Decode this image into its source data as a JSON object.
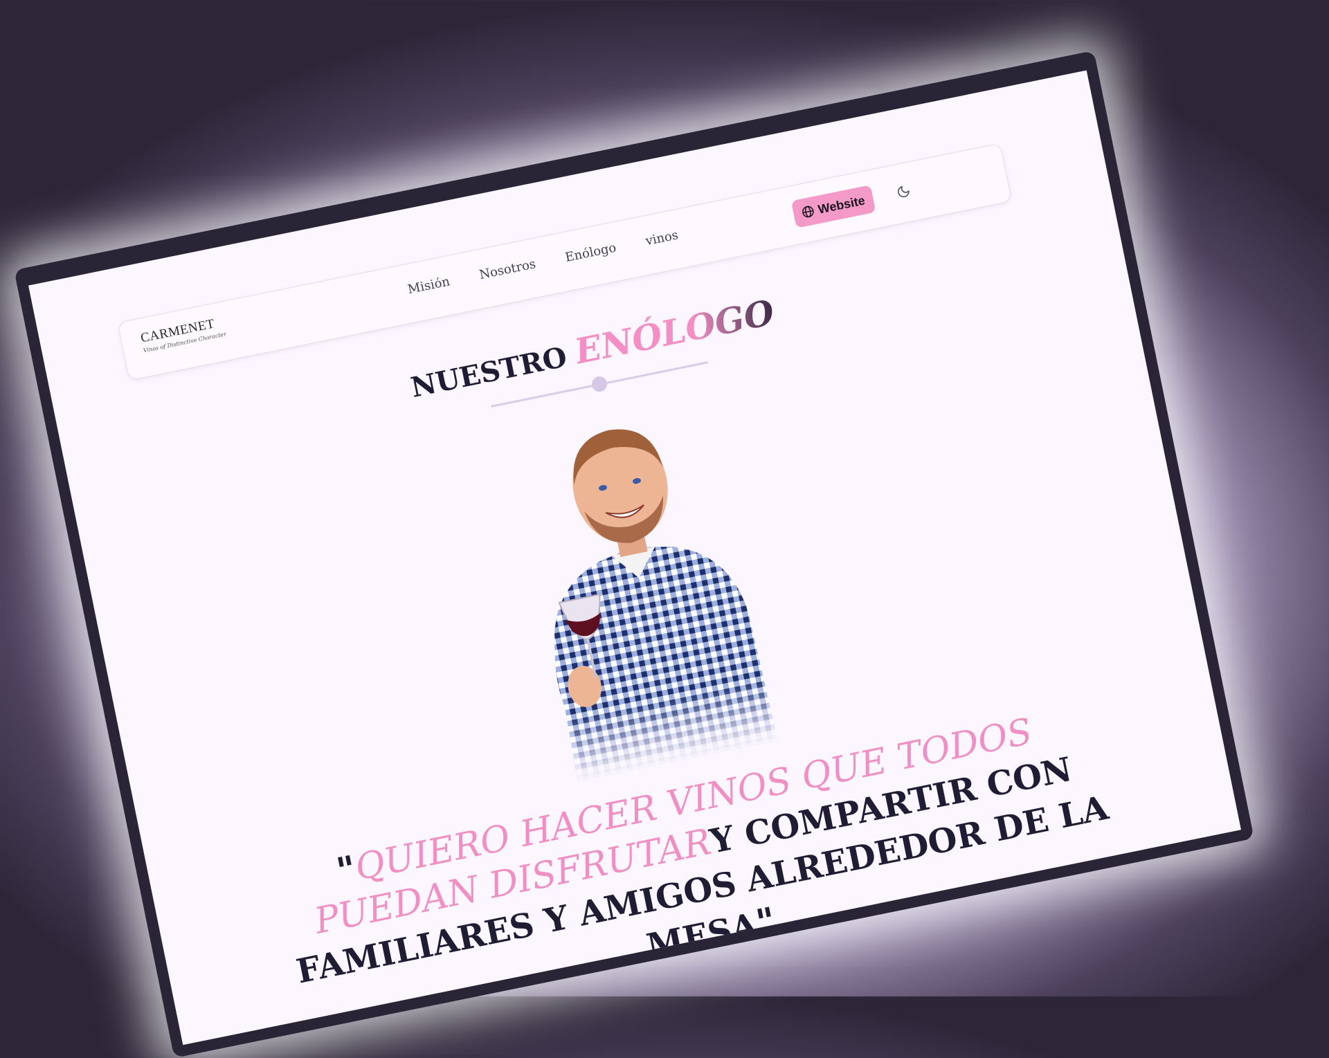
{
  "brand": {
    "name": "CARMENET",
    "tagline": "Vinos of Distinctive Character"
  },
  "nav": {
    "links": [
      "Misión",
      "Nosotros",
      "Enólogo",
      "vinos"
    ],
    "website_label": "Website"
  },
  "section": {
    "title_prefix": "NUESTRO",
    "title_accent": "ENÓLOGO"
  },
  "quote": {
    "open": "\"",
    "accent": "QUIERO HACER VINOS QUE TODOS PUEDAN DISFRUTAR",
    "rest": "Y COMPARTIR CON FAMILIARES Y AMIGOS ALREDEDOR DE LA MESA",
    "close": "\""
  },
  "colors": {
    "accent_pink": "#f49ac9",
    "title_dark": "#1f1d33",
    "page_bg": "#fbf6ff"
  },
  "icons": [
    "globe-icon",
    "moon-icon"
  ]
}
